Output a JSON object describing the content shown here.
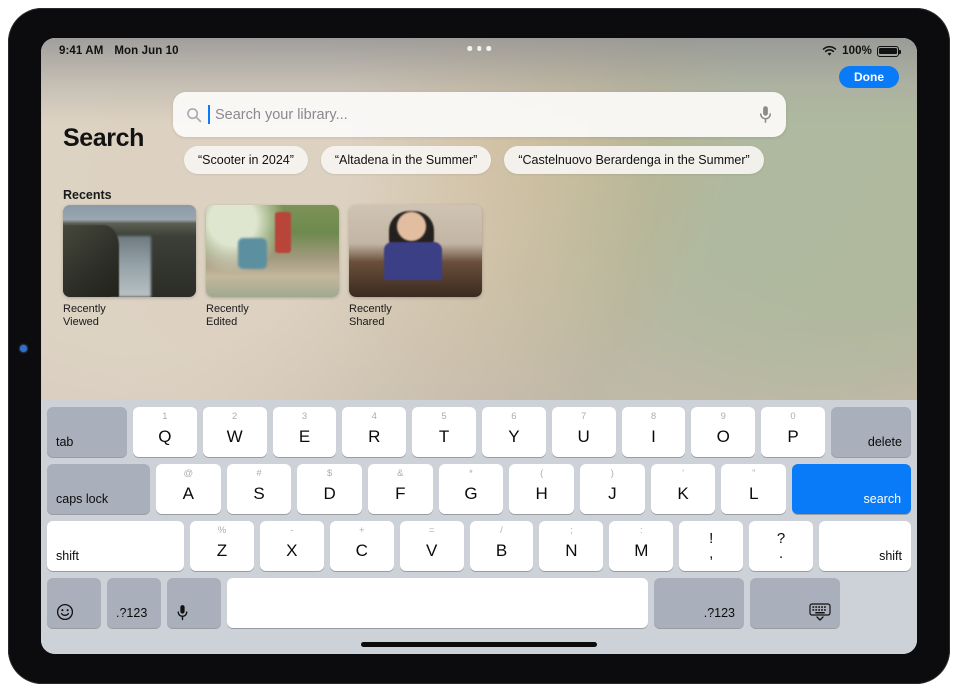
{
  "status_bar": {
    "time": "9:41 AM",
    "date": "Mon Jun 10",
    "wifi_icon": "wifi-icon",
    "battery_percent": "100%",
    "battery_icon": "battery-full-icon",
    "multitask_dots": "multitasking-control-icon"
  },
  "header": {
    "title": "Search",
    "done_label": "Done"
  },
  "search": {
    "placeholder": "Search your library...",
    "value": "",
    "search_icon": "magnifying-glass-icon",
    "mic_icon": "microphone-icon"
  },
  "suggestions": [
    {
      "label": "“Scooter in 2024”"
    },
    {
      "label": "“Altadena in the Summer”"
    },
    {
      "label": "“Castelnuovo Berardenga in the Summer”"
    }
  ],
  "recents": {
    "heading": "Recents",
    "items": [
      {
        "label": "Recently\nViewed",
        "thumb": "coastal-cliffs-photo"
      },
      {
        "label": "Recently\nEdited",
        "thumb": "forest-stream-photo"
      },
      {
        "label": "Recently\nShared",
        "thumb": "chess-player-photo"
      }
    ]
  },
  "keyboard": {
    "row1": {
      "tab": "tab",
      "keys": [
        {
          "hint": "1",
          "glyph": "Q"
        },
        {
          "hint": "2",
          "glyph": "W"
        },
        {
          "hint": "3",
          "glyph": "E"
        },
        {
          "hint": "4",
          "glyph": "R"
        },
        {
          "hint": "5",
          "glyph": "T"
        },
        {
          "hint": "6",
          "glyph": "Y"
        },
        {
          "hint": "7",
          "glyph": "U"
        },
        {
          "hint": "8",
          "glyph": "I"
        },
        {
          "hint": "9",
          "glyph": "O"
        },
        {
          "hint": "0",
          "glyph": "P"
        }
      ],
      "delete": "delete"
    },
    "row2": {
      "caps_lock": "caps lock",
      "keys": [
        {
          "hint": "@",
          "glyph": "A"
        },
        {
          "hint": "#",
          "glyph": "S"
        },
        {
          "hint": "$",
          "glyph": "D"
        },
        {
          "hint": "&",
          "glyph": "F"
        },
        {
          "hint": "*",
          "glyph": "G"
        },
        {
          "hint": "(",
          "glyph": "H"
        },
        {
          "hint": ")",
          "glyph": "J"
        },
        {
          "hint": "’",
          "glyph": "K"
        },
        {
          "hint": "”",
          "glyph": "L"
        }
      ],
      "search": "search"
    },
    "row3": {
      "shift_left": "shift",
      "keys": [
        {
          "hint": "%",
          "glyph": "Z"
        },
        {
          "hint": "-",
          "glyph": "X"
        },
        {
          "hint": "+",
          "glyph": "C"
        },
        {
          "hint": "=",
          "glyph": "V"
        },
        {
          "hint": "/",
          "glyph": "B"
        },
        {
          "hint": ";",
          "glyph": "N"
        },
        {
          "hint": ":",
          "glyph": "M"
        }
      ],
      "punct1_top": "!",
      "punct1_bottom": ",",
      "punct2_top": "?",
      "punct2_bottom": ".",
      "shift_right": "shift"
    },
    "row4": {
      "emoji_icon": "emoji-smiley-icon",
      "numbers_left": ".?123",
      "dictation_icon": "microphone-icon",
      "space": "",
      "numbers_right": ".?123",
      "dismiss_icon": "dismiss-keyboard-icon"
    }
  },
  "colors": {
    "accent_blue": "#0a7bf8",
    "keyboard_bg": "#cdd1d8",
    "modifier_key": "#a9b0bb",
    "key_white": "#ffffff"
  }
}
